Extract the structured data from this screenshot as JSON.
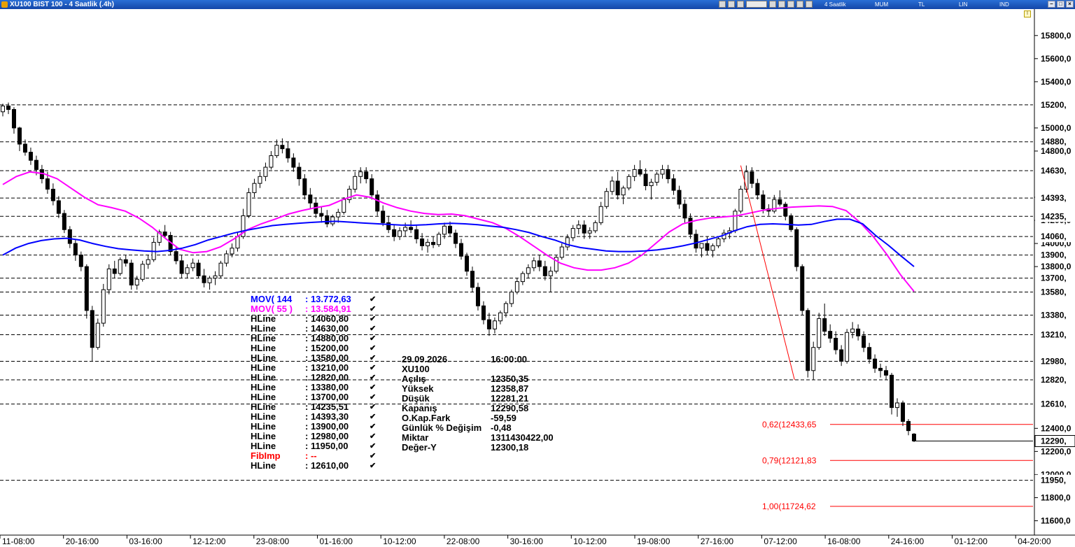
{
  "window": {
    "title": "XU100 BIST 100 - 4 Saatlik (.4h)",
    "toolbar_labels": [
      "4 Saatlik",
      "MUM",
      "TL",
      "LIN",
      "IND"
    ],
    "pin_label": "I"
  },
  "chart_data": {
    "type": "candlestick",
    "symbol": "XU100",
    "ylim": [
      11500,
      15950
    ],
    "y_ticks": [
      {
        "value": 15800,
        "label": "15800,0"
      },
      {
        "value": 15600,
        "label": "15600,0"
      },
      {
        "value": 15400,
        "label": "15400,0"
      },
      {
        "value": 15000,
        "label": "15000,0"
      },
      {
        "value": 14800,
        "label": "14800,0"
      },
      {
        "value": 14400,
        "label": "14400,0"
      },
      {
        "value": 14200,
        "label": "14200,0"
      },
      {
        "value": 14000,
        "label": "14000,0"
      },
      {
        "value": 13800,
        "label": "13800,0"
      },
      {
        "value": 12400,
        "label": "12400,0"
      },
      {
        "value": 12200,
        "label": "12200,0"
      },
      {
        "value": 12000,
        "label": "12000,0"
      },
      {
        "value": 11800,
        "label": "11800,0"
      },
      {
        "value": 11600,
        "label": "11600,0"
      }
    ],
    "x_ticks": [
      "11-08:00",
      "20-16:00",
      "03-16:00",
      "12-12:00",
      "23-08:00",
      "01-16:00",
      "10-12:00",
      "22-08:00",
      "30-16:00",
      "10-12:00",
      "19-08:00",
      "27-16:00",
      "07-12:00",
      "16-08:00",
      "24-16:00",
      "01-12:00",
      "04-20:00"
    ],
    "hlines": [
      {
        "value": 15200,
        "label": "15200,"
      },
      {
        "value": 14880,
        "label": "14880,"
      },
      {
        "value": 14630,
        "label": "14630,"
      },
      {
        "value": 14393,
        "label": "14393,"
      },
      {
        "value": 14235,
        "label": "14235,"
      },
      {
        "value": 14060,
        "label": "14060,"
      },
      {
        "value": 13900,
        "label": "13900,"
      },
      {
        "value": 13700,
        "label": "13700,"
      },
      {
        "value": 13580,
        "label": "13580,"
      },
      {
        "value": 13380,
        "label": "13380,"
      },
      {
        "value": 13210,
        "label": "13210,"
      },
      {
        "value": 12980,
        "label": "12980,"
      },
      {
        "value": 12820,
        "label": "12820,"
      },
      {
        "value": 12610,
        "label": "12610,"
      },
      {
        "value": 11950,
        "label": "11950,"
      }
    ],
    "last_price": {
      "value": 12290,
      "label": "12290,"
    },
    "fib_levels": [
      {
        "value": 12433.65,
        "label": "0,62(12433,65"
      },
      {
        "value": 12121.83,
        "label": "0,79(12121,83"
      },
      {
        "value": 11724.62,
        "label": "1,00(11724,62"
      }
    ],
    "fib_line": {
      "start": {
        "x": "07-12:00",
        "y": 14675
      },
      "end": {
        "x": "16-08:00",
        "y": 12820
      }
    },
    "ma144": [
      13900,
      13960,
      14000,
      14025,
      14040,
      14045,
      14030,
      14000,
      13975,
      13955,
      13945,
      13935,
      13930,
      13940,
      13960,
      13990,
      14030,
      14060,
      14090,
      14115,
      14135,
      14155,
      14165,
      14175,
      14182,
      14188,
      14192,
      14185,
      14178,
      14172,
      14165,
      14160,
      14158,
      14162,
      14170,
      14175,
      14170,
      14162,
      14150,
      14140,
      14120,
      14095,
      14060,
      14030,
      13990,
      13965,
      13950,
      13935,
      13930,
      13930,
      13935,
      13945,
      13960,
      13980,
      14005,
      14035,
      14065,
      14110,
      14145,
      14165,
      14170,
      14165,
      14160,
      14165,
      14190,
      14210,
      14210,
      14170,
      14070,
      13985,
      13890,
      13800
    ],
    "ma55": [
      14510,
      14580,
      14620,
      14605,
      14560,
      14480,
      14400,
      14335,
      14310,
      14280,
      14220,
      14140,
      14040,
      13950,
      13920,
      13930,
      13970,
      14040,
      14120,
      14170,
      14210,
      14255,
      14285,
      14310,
      14330,
      14380,
      14420,
      14400,
      14350,
      14310,
      14280,
      14260,
      14250,
      14255,
      14240,
      14210,
      14180,
      14130,
      14060,
      13980,
      13900,
      13830,
      13790,
      13770,
      13770,
      13790,
      13830,
      13900,
      14000,
      14100,
      14170,
      14200,
      14220,
      14230,
      14240,
      14265,
      14290,
      14305,
      14315,
      14320,
      14325,
      14320,
      14285,
      14185,
      14060,
      13905,
      13730,
      13585
    ],
    "candles": [
      [
        15140,
        15210,
        15100,
        15190
      ],
      [
        15190,
        15220,
        15120,
        15160
      ],
      [
        15160,
        15180,
        14950,
        15000
      ],
      [
        15000,
        15010,
        14800,
        14860
      ],
      [
        14860,
        14900,
        14760,
        14790
      ],
      [
        14790,
        14830,
        14680,
        14720
      ],
      [
        14720,
        14760,
        14590,
        14640
      ],
      [
        14640,
        14680,
        14520,
        14560
      ],
      [
        14560,
        14620,
        14430,
        14470
      ],
      [
        14470,
        14520,
        14330,
        14370
      ],
      [
        14370,
        14410,
        14220,
        14260
      ],
      [
        14260,
        14290,
        14090,
        14120
      ],
      [
        14120,
        14150,
        13960,
        14000
      ],
      [
        14000,
        14030,
        13850,
        13900
      ],
      [
        13900,
        13930,
        13760,
        13800
      ],
      [
        13800,
        13820,
        13350,
        13420
      ],
      [
        13420,
        13460,
        12980,
        13100
      ],
      [
        13100,
        13350,
        13080,
        13310
      ],
      [
        13310,
        13650,
        13280,
        13600
      ],
      [
        13600,
        13820,
        13560,
        13780
      ],
      [
        13780,
        13850,
        13700,
        13740
      ],
      [
        13740,
        13880,
        13720,
        13860
      ],
      [
        13860,
        13900,
        13800,
        13830
      ],
      [
        13830,
        13860,
        13600,
        13640
      ],
      [
        13640,
        13720,
        13600,
        13690
      ],
      [
        13690,
        13850,
        13670,
        13820
      ],
      [
        13820,
        13900,
        13780,
        13860
      ],
      [
        13860,
        14050,
        13840,
        14010
      ],
      [
        14010,
        14120,
        13980,
        14100
      ],
      [
        14100,
        14160,
        14050,
        14070
      ],
      [
        14070,
        14100,
        13900,
        13930
      ],
      [
        13930,
        13980,
        13820,
        13850
      ],
      [
        13850,
        13900,
        13700,
        13740
      ],
      [
        13740,
        13820,
        13700,
        13790
      ],
      [
        13790,
        13870,
        13760,
        13830
      ],
      [
        13830,
        13860,
        13700,
        13720
      ],
      [
        13720,
        13780,
        13620,
        13660
      ],
      [
        13660,
        13720,
        13600,
        13700
      ],
      [
        13700,
        13760,
        13640,
        13720
      ],
      [
        13720,
        13850,
        13700,
        13830
      ],
      [
        13830,
        13940,
        13800,
        13910
      ],
      [
        13910,
        14000,
        13880,
        13960
      ],
      [
        13960,
        14100,
        13930,
        14060
      ],
      [
        14060,
        14300,
        14040,
        14240
      ],
      [
        14240,
        14480,
        14220,
        14440
      ],
      [
        14440,
        14560,
        14400,
        14520
      ],
      [
        14520,
        14620,
        14480,
        14580
      ],
      [
        14580,
        14700,
        14540,
        14660
      ],
      [
        14660,
        14800,
        14640,
        14760
      ],
      [
        14760,
        14900,
        14740,
        14850
      ],
      [
        14850,
        14910,
        14780,
        14820
      ],
      [
        14820,
        14880,
        14700,
        14740
      ],
      [
        14740,
        14780,
        14620,
        14660
      ],
      [
        14660,
        14700,
        14500,
        14560
      ],
      [
        14560,
        14600,
        14380,
        14420
      ],
      [
        14420,
        14480,
        14300,
        14350
      ],
      [
        14350,
        14400,
        14220,
        14260
      ],
      [
        14260,
        14320,
        14180,
        14240
      ],
      [
        14240,
        14290,
        14140,
        14170
      ],
      [
        14170,
        14250,
        14150,
        14230
      ],
      [
        14230,
        14300,
        14180,
        14270
      ],
      [
        14270,
        14400,
        14250,
        14380
      ],
      [
        14380,
        14500,
        14350,
        14470
      ],
      [
        14470,
        14620,
        14440,
        14580
      ],
      [
        14580,
        14660,
        14520,
        14620
      ],
      [
        14620,
        14660,
        14520,
        14560
      ],
      [
        14560,
        14600,
        14380,
        14420
      ],
      [
        14420,
        14460,
        14240,
        14280
      ],
      [
        14280,
        14330,
        14150,
        14180
      ],
      [
        14180,
        14240,
        14090,
        14120
      ],
      [
        14120,
        14160,
        14020,
        14060
      ],
      [
        14060,
        14140,
        14030,
        14110
      ],
      [
        14110,
        14180,
        14060,
        14140
      ],
      [
        14140,
        14200,
        14090,
        14120
      ],
      [
        14120,
        14160,
        14000,
        14040
      ],
      [
        14040,
        14090,
        13940,
        13980
      ],
      [
        13980,
        14040,
        13920,
        14010
      ],
      [
        14010,
        14060,
        13960,
        13990
      ],
      [
        13990,
        14100,
        13970,
        14080
      ],
      [
        14080,
        14180,
        14040,
        14150
      ],
      [
        14150,
        14190,
        14060,
        14090
      ],
      [
        14090,
        14120,
        13960,
        14000
      ],
      [
        14000,
        14040,
        13860,
        13890
      ],
      [
        13890,
        13920,
        13720,
        13760
      ],
      [
        13760,
        13800,
        13580,
        13620
      ],
      [
        13620,
        13660,
        13420,
        13460
      ],
      [
        13460,
        13500,
        13300,
        13340
      ],
      [
        13340,
        13400,
        13200,
        13260
      ],
      [
        13260,
        13360,
        13220,
        13330
      ],
      [
        13330,
        13420,
        13300,
        13400
      ],
      [
        13400,
        13500,
        13360,
        13480
      ],
      [
        13480,
        13600,
        13450,
        13580
      ],
      [
        13580,
        13700,
        13560,
        13670
      ],
      [
        13670,
        13760,
        13640,
        13740
      ],
      [
        13740,
        13820,
        13700,
        13790
      ],
      [
        13790,
        13880,
        13760,
        13850
      ],
      [
        13850,
        13900,
        13760,
        13800
      ],
      [
        13800,
        13850,
        13680,
        13720
      ],
      [
        13720,
        13800,
        13580,
        13760
      ],
      [
        13760,
        13900,
        13740,
        13880
      ],
      [
        13880,
        14000,
        13860,
        13970
      ],
      [
        13970,
        14080,
        13940,
        14050
      ],
      [
        14050,
        14160,
        14020,
        14130
      ],
      [
        14130,
        14200,
        14080,
        14160
      ],
      [
        14160,
        14200,
        14040,
        14090
      ],
      [
        14090,
        14140,
        14040,
        14110
      ],
      [
        14110,
        14200,
        14090,
        14180
      ],
      [
        14180,
        14360,
        14160,
        14320
      ],
      [
        14320,
        14480,
        14300,
        14450
      ],
      [
        14450,
        14580,
        14420,
        14540
      ],
      [
        14540,
        14620,
        14380,
        14420
      ],
      [
        14420,
        14500,
        14340,
        14480
      ],
      [
        14480,
        14600,
        14460,
        14580
      ],
      [
        14580,
        14680,
        14540,
        14640
      ],
      [
        14640,
        14720,
        14580,
        14600
      ],
      [
        14600,
        14650,
        14460,
        14500
      ],
      [
        14500,
        14560,
        14380,
        14530
      ],
      [
        14530,
        14620,
        14500,
        14600
      ],
      [
        14600,
        14680,
        14560,
        14640
      ],
      [
        14640,
        14680,
        14520,
        14560
      ],
      [
        14560,
        14600,
        14420,
        14460
      ],
      [
        14460,
        14500,
        14300,
        14340
      ],
      [
        14340,
        14380,
        14180,
        14220
      ],
      [
        14220,
        14260,
        14040,
        14080
      ],
      [
        14080,
        14120,
        13920,
        13960
      ],
      [
        13960,
        14000,
        13880,
        14000
      ],
      [
        14000,
        14060,
        13900,
        13940
      ],
      [
        13940,
        14000,
        13880,
        13980
      ],
      [
        13980,
        14060,
        13960,
        14040
      ],
      [
        14040,
        14120,
        14010,
        14090
      ],
      [
        14090,
        14140,
        14040,
        14110
      ],
      [
        14110,
        14300,
        14090,
        14280
      ],
      [
        14280,
        14500,
        14260,
        14470
      ],
      [
        14470,
        14675,
        14440,
        14620
      ],
      [
        14620,
        14660,
        14480,
        14520
      ],
      [
        14520,
        14560,
        14380,
        14420
      ],
      [
        14420,
        14460,
        14260,
        14300
      ],
      [
        14300,
        14340,
        14240,
        14280
      ],
      [
        14280,
        14420,
        14260,
        14380
      ],
      [
        14380,
        14460,
        14320,
        14340
      ],
      [
        14340,
        14360,
        14200,
        14240
      ],
      [
        14240,
        14260,
        14100,
        14120
      ],
      [
        14120,
        14140,
        13760,
        13800
      ],
      [
        13800,
        13820,
        13380,
        13420
      ],
      [
        13420,
        13440,
        12840,
        12900
      ],
      [
        12900,
        13150,
        12820,
        13100
      ],
      [
        13100,
        13400,
        13080,
        13350
      ],
      [
        13350,
        13480,
        13200,
        13240
      ],
      [
        13240,
        13300,
        13140,
        13180
      ],
      [
        13180,
        13240,
        13040,
        13080
      ],
      [
        13080,
        13120,
        12940,
        12980
      ],
      [
        12980,
        13260,
        12960,
        13230
      ],
      [
        13230,
        13320,
        13180,
        13260
      ],
      [
        13260,
        13300,
        13160,
        13200
      ],
      [
        13200,
        13240,
        13060,
        13100
      ],
      [
        13100,
        13140,
        12960,
        13000
      ],
      [
        13000,
        13040,
        12880,
        12920
      ],
      [
        12920,
        12960,
        12840,
        12900
      ],
      [
        12900,
        12940,
        12820,
        12860
      ],
      [
        12860,
        12880,
        12520,
        12580
      ],
      [
        12580,
        12660,
        12500,
        12620
      ],
      [
        12620,
        12640,
        12420,
        12460
      ],
      [
        12460,
        12480,
        12340,
        12380
      ],
      [
        12350.35,
        12358.87,
        12281.21,
        12290.58
      ]
    ]
  },
  "legend": [
    {
      "name": "MOV( 144",
      "value": ": 13.772,63",
      "color": "#0000ff"
    },
    {
      "name": "MOV( 55 )",
      "value": ": 13.584,91",
      "color": "#ff00ff"
    },
    {
      "name": "HLine",
      "value": ": 14060,80",
      "color": "#000000"
    },
    {
      "name": "HLine",
      "value": ": 14630,00",
      "color": "#000000"
    },
    {
      "name": "HLine",
      "value": ": 14880,00",
      "color": "#000000"
    },
    {
      "name": "HLine",
      "value": ": 15200,00",
      "color": "#000000"
    },
    {
      "name": "HLine",
      "value": ": 13580,00",
      "color": "#000000"
    },
    {
      "name": "HLine",
      "value": ": 13210,00",
      "color": "#000000"
    },
    {
      "name": "HLine",
      "value": ": 12820,00",
      "color": "#000000"
    },
    {
      "name": "HLine",
      "value": ": 13380,00",
      "color": "#000000"
    },
    {
      "name": "HLine",
      "value": ": 13700,00",
      "color": "#000000"
    },
    {
      "name": "HLine",
      "value": ": 14235,51",
      "color": "#000000"
    },
    {
      "name": "HLine",
      "value": ": 14393,30",
      "color": "#000000"
    },
    {
      "name": "HLine",
      "value": ": 13900,00",
      "color": "#000000"
    },
    {
      "name": "HLine",
      "value": ": 12980,00",
      "color": "#000000"
    },
    {
      "name": "HLine",
      "value": ": 11950,00",
      "color": "#000000"
    },
    {
      "name": "FibImp",
      "value": ": --",
      "color": "#ff0000"
    },
    {
      "name": "HLine",
      "value": ": 12610,00",
      "color": "#000000"
    }
  ],
  "info_panel": [
    {
      "key": "29.09.2026",
      "value": "16:00:00"
    },
    {
      "key": "XU100",
      "value": ""
    },
    {
      "key": "Açılış",
      "value": "12350,35"
    },
    {
      "key": "Yüksek",
      "value": "12358,87"
    },
    {
      "key": "Düşük",
      "value": "12281,21"
    },
    {
      "key": "Kapanış",
      "value": "12290,58"
    },
    {
      "key": "O.Kap.Fark",
      "value": "-59,59"
    },
    {
      "key": "Günlük % Değişim",
      "value": "-0,48"
    },
    {
      "key": "Miktar",
      "value": "1311430422,00"
    },
    {
      "key": "Değer-Y",
      "value": "12300,18"
    }
  ],
  "colors": {
    "ma144": "#0000ff",
    "ma55": "#ff00ff",
    "fib": "#ff0000",
    "candle": "#000000",
    "titlebar": "#1a55c0"
  }
}
